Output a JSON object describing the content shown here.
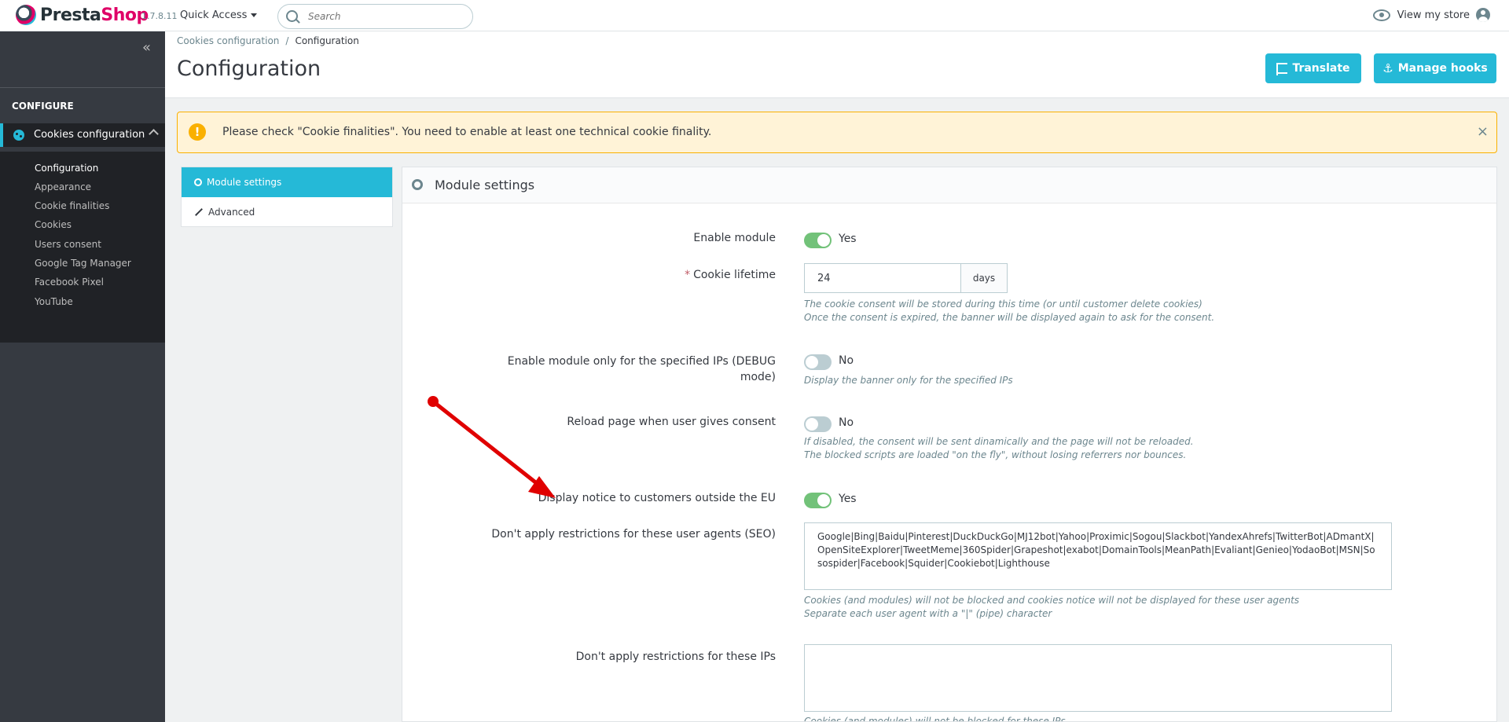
{
  "topbar": {
    "logo_part1": "Presta",
    "logo_part2": "Shop",
    "version": "1.7.8.11",
    "quick_access": "Quick Access",
    "search_placeholder": "Search",
    "view_store": "View my store"
  },
  "sidebar": {
    "section_title": "CONFIGURE",
    "parent_item": "Cookies configuration",
    "items": [
      {
        "label": "Configuration",
        "active": true
      },
      {
        "label": "Appearance"
      },
      {
        "label": "Cookie finalities"
      },
      {
        "label": "Cookies"
      },
      {
        "label": "Users consent"
      },
      {
        "label": "Google Tag Manager"
      },
      {
        "label": "Facebook Pixel"
      },
      {
        "label": "YouTube"
      }
    ]
  },
  "header": {
    "breadcrumb": [
      "Cookies configuration",
      "/",
      "Configuration"
    ],
    "title": "Configuration",
    "translate_label": "Translate",
    "manage_hooks_label": "Manage hooks"
  },
  "alert": {
    "text": "Please check \"Cookie finalities\". You need to enable at least one technical cookie finality.",
    "close": "×"
  },
  "tabs": [
    {
      "label": "Module settings",
      "active": true
    },
    {
      "label": "Advanced"
    }
  ],
  "panel": {
    "title": "Module settings",
    "fields": {
      "enable_module": {
        "label": "Enable module",
        "state": "Yes"
      },
      "cookie_lifetime": {
        "required_mark": "*",
        "label": "Cookie lifetime",
        "value": "24",
        "unit": "days",
        "help1": "The cookie consent will be stored during this time (or until customer delete cookies)",
        "help2": "Once the consent is expired, the banner will be displayed again to ask for the consent."
      },
      "debug_mode": {
        "label_line1": "Enable module only for the specified IPs (DEBUG",
        "label_line2": "mode)",
        "state": "No",
        "help": "Display the banner only for the specified IPs"
      },
      "reload_page": {
        "label": "Reload page when user gives consent",
        "state": "No",
        "help1": "If disabled, the consent will be sent dinamically and the page will not be reloaded.",
        "help2": "The blocked scripts are loaded \"on the fly\", without losing referrers nor bounces."
      },
      "outside_eu": {
        "label": "Display notice to customers outside the EU",
        "state": "Yes"
      },
      "user_agents": {
        "label": "Don't apply restrictions for these user agents (SEO)",
        "value": "Google|Bing|Baidu|Pinterest|DuckDuckGo|MJ12bot|Yahoo|Proximic|Sogou|Slackbot|YandexAhrefs|TwitterBot|ADmantX|OpenSiteExplorer|TweetMeme|360Spider|Grapeshot|exabot|DomainTools|MeanPath|Evaliant|Genieo|YodaoBot|MSN|Sosospider|Facebook|Squider|Cookiebot|Lighthouse",
        "help1": "Cookies (and modules) will not be blocked and cookies notice will not be displayed for these user agents",
        "help2": "Separate each user agent with a \"|\" (pipe) character"
      },
      "ips": {
        "label": "Don't apply restrictions for these IPs",
        "value": "",
        "help": "Cookies (and modules) will not be blocked for these IPs"
      }
    }
  },
  "colors": {
    "accent": "#25b9d7",
    "toggle_on": "#72c279",
    "toggle_off": "#bbcdd2",
    "warning": "#fab000",
    "arrow": "#e00000"
  }
}
